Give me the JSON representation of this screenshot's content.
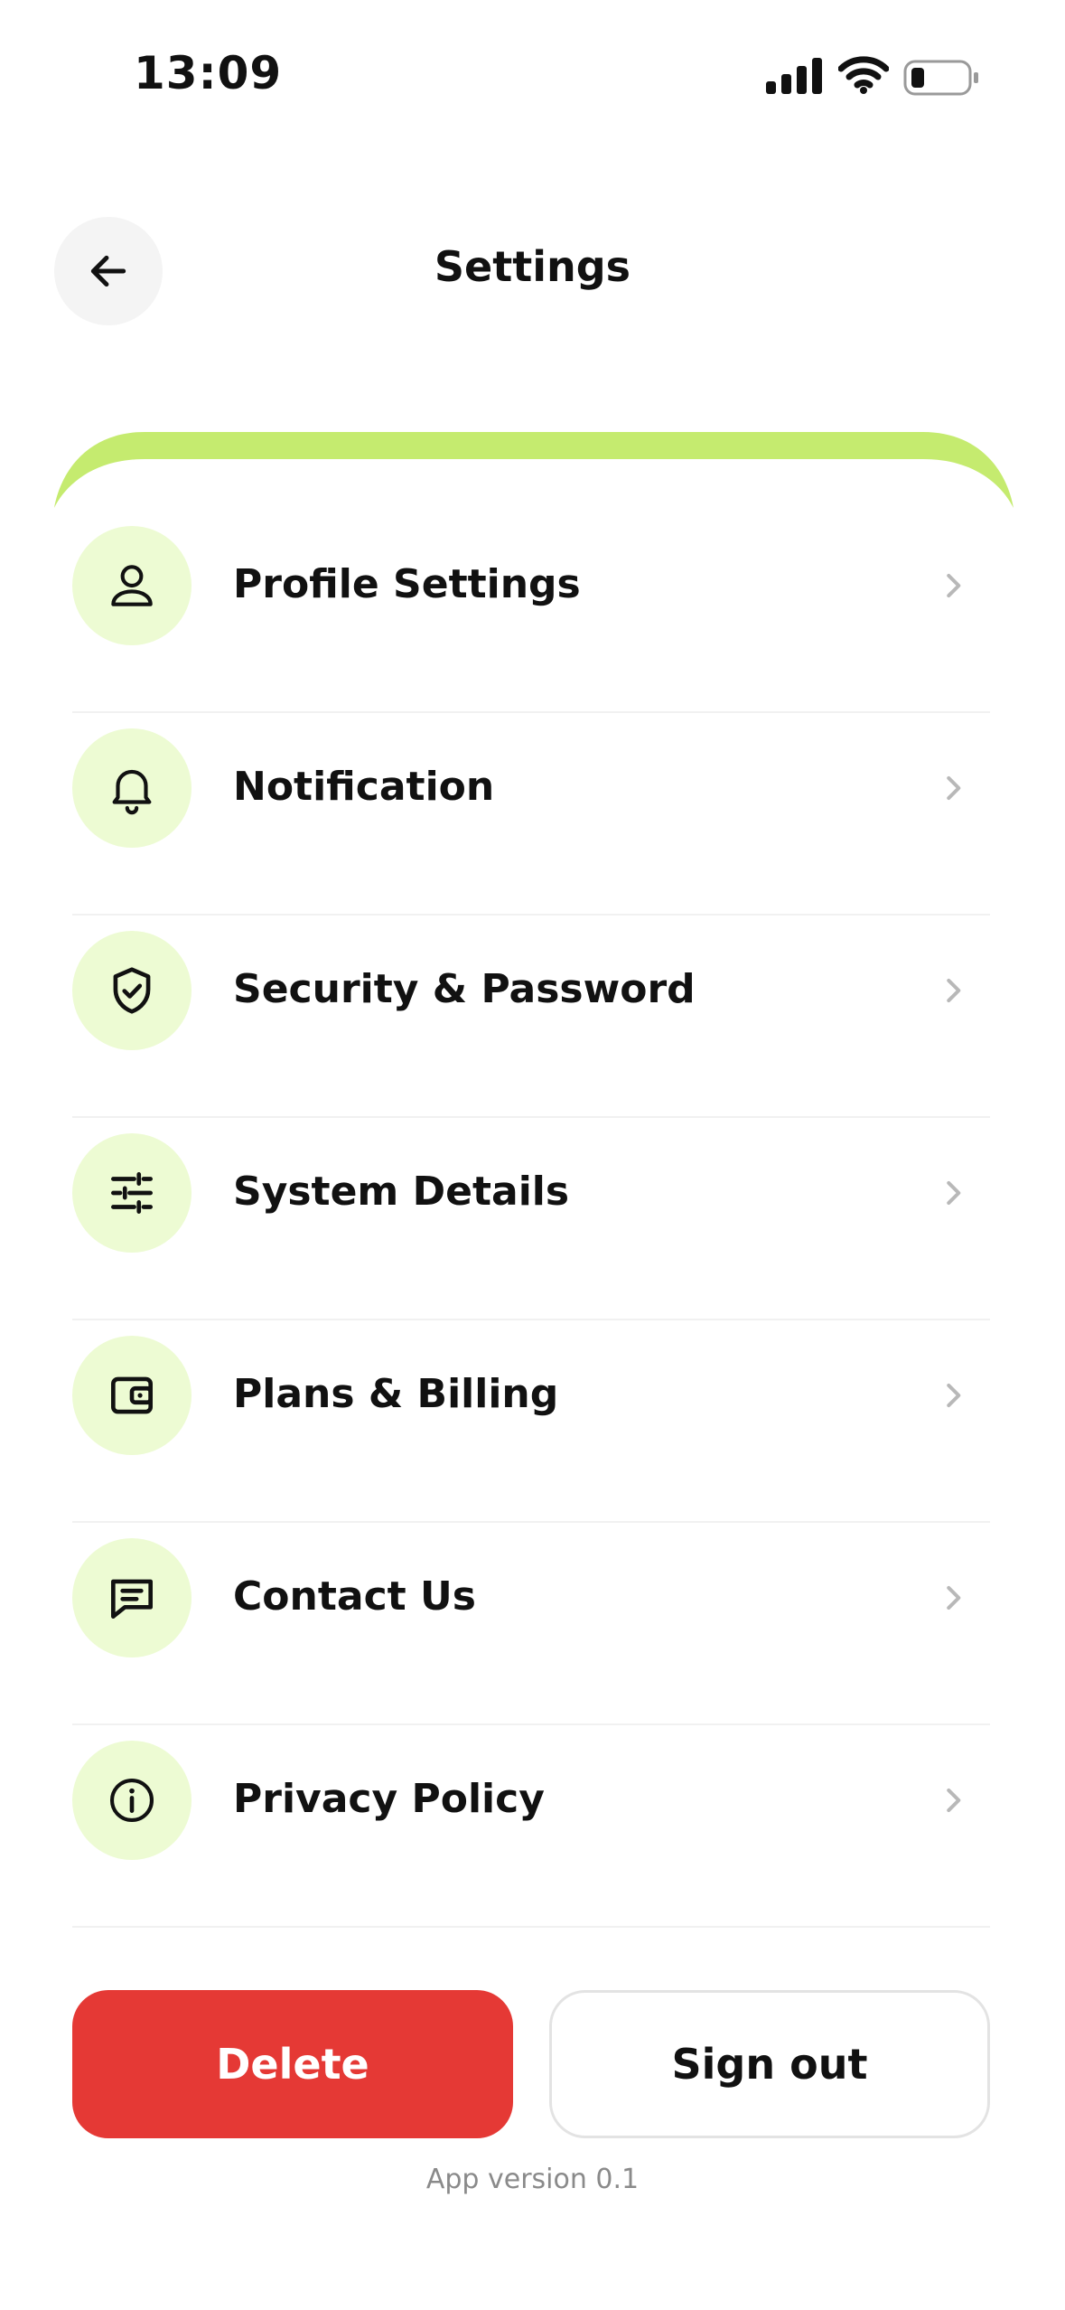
{
  "status_bar": {
    "time": "13:09",
    "icons": [
      "signal-icon",
      "wifi-icon",
      "battery-icon"
    ]
  },
  "header": {
    "title": "Settings",
    "back_icon": "arrow-left-icon"
  },
  "colors": {
    "accent": "#c5eb6f",
    "icon_bg": "#edfbd3",
    "danger": "#e53935",
    "divider": "#f1f1f1",
    "chevron": "#b8b8b8"
  },
  "menu": {
    "items": [
      {
        "label": "Profile Settings",
        "icon": "user-icon"
      },
      {
        "label": "Notification",
        "icon": "bell-icon"
      },
      {
        "label": "Security & Password",
        "icon": "shield-check-icon"
      },
      {
        "label": "System Details",
        "icon": "sliders-icon"
      },
      {
        "label": "Plans & Billing",
        "icon": "wallet-icon"
      },
      {
        "label": "Contact Us",
        "icon": "message-icon"
      },
      {
        "label": "Privacy Policy",
        "icon": "info-icon"
      }
    ]
  },
  "actions": {
    "delete_label": "Delete",
    "signout_label": "Sign out"
  },
  "footer": {
    "version": "App version 0.1"
  }
}
